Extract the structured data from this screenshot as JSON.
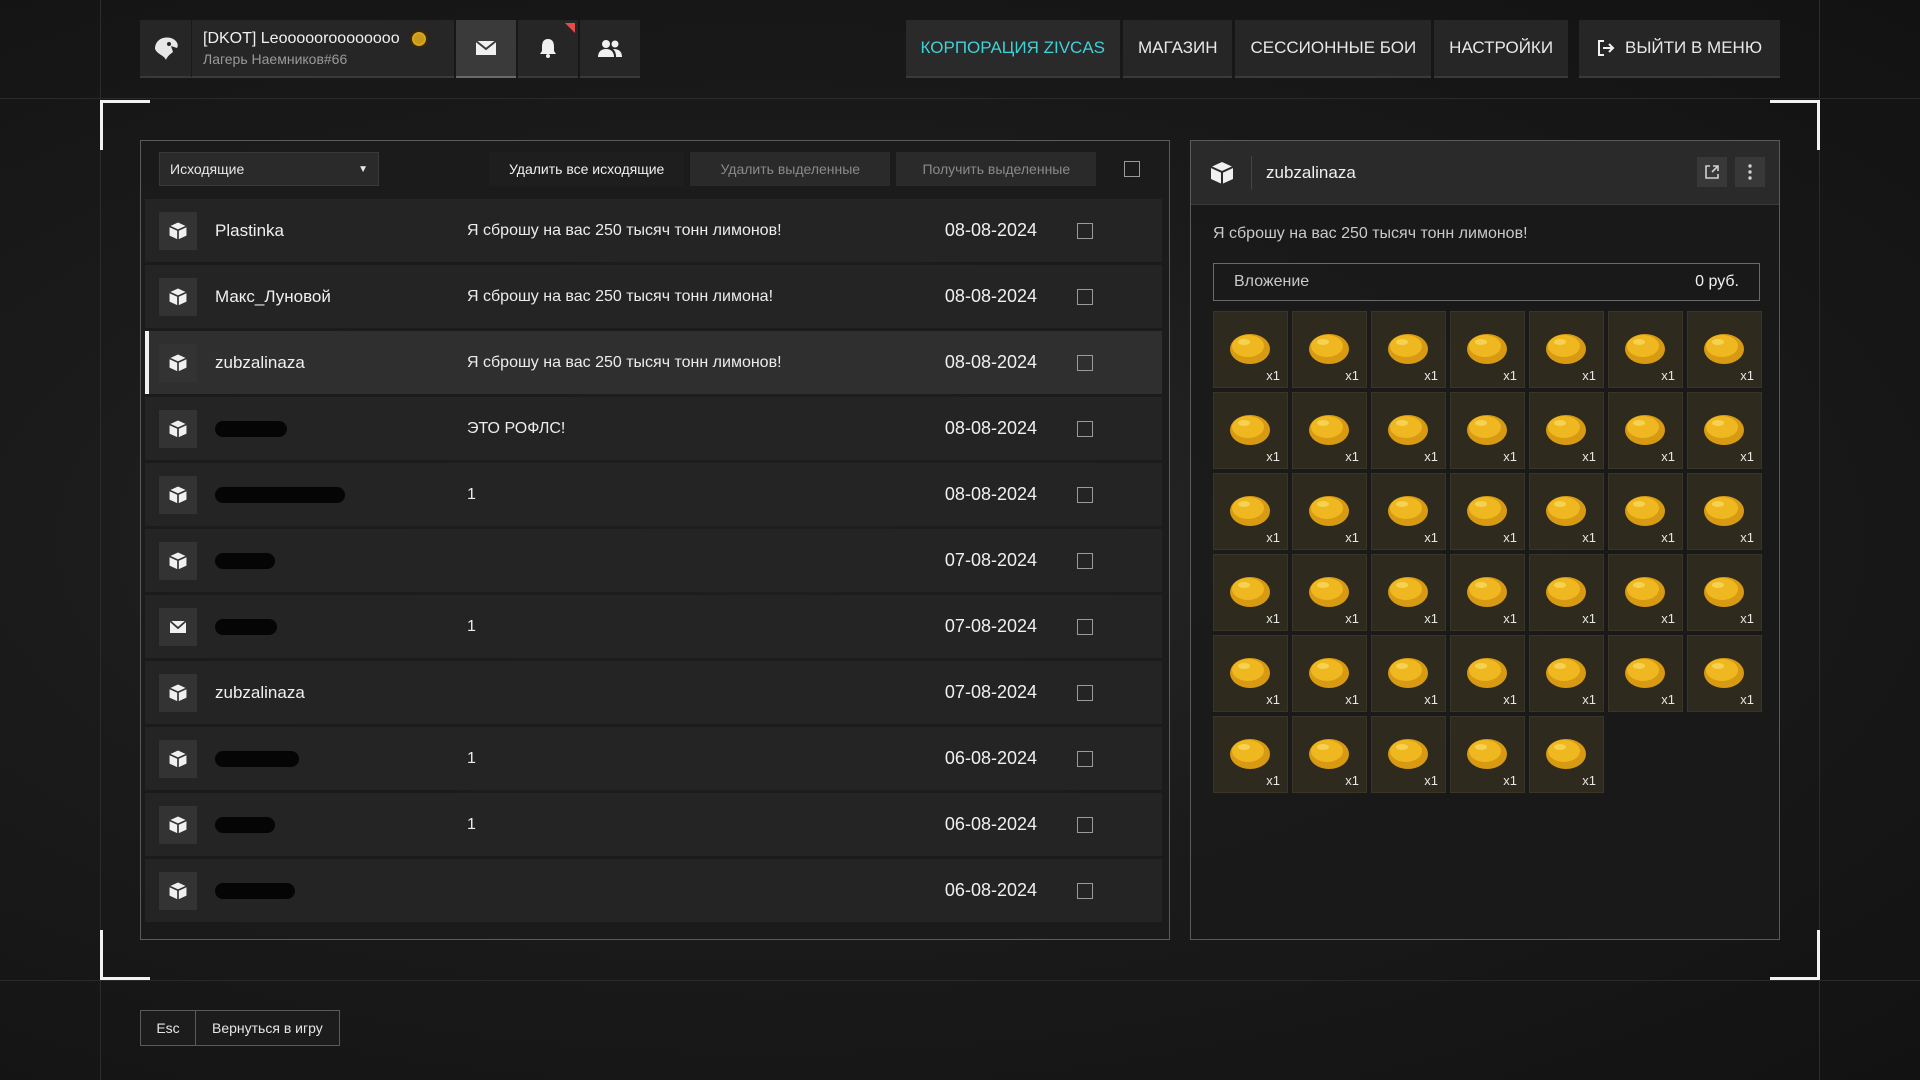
{
  "profile": {
    "name": "[DKOT] Leoooooroooooooo",
    "clan": "Лагерь Наемников#66"
  },
  "top_icons": [
    "mail-icon",
    "bell-icon",
    "friends-icon"
  ],
  "nav": {
    "corp": "КОРПОРАЦИЯ ZIVCAS",
    "shop": "МАГАЗИН",
    "session": "СЕССИОННЫЕ БОИ",
    "settings": "НАСТРОЙКИ",
    "exit": "ВЫЙТИ В МЕНЮ"
  },
  "colors": {
    "accent": "#3fd1d8",
    "notif": "#e84a4a",
    "lemon": "#e0a81a"
  },
  "toolbar": {
    "folder": "Исходящие",
    "delete_all": "Удалить все исходящие",
    "delete_selected": "Удалить выделенные",
    "receive_selected": "Получить выделенные"
  },
  "mails": [
    {
      "icon": "package-icon",
      "sender": "Plastinka",
      "subject": "Я сброшу на вас 250 тысяч тонн лимонов!",
      "date": "08-08-2024"
    },
    {
      "icon": "package-icon",
      "sender": "Макс_Луновой",
      "subject": "Я сброшу на вас 250 тысяч тонн лимона!",
      "date": "08-08-2024"
    },
    {
      "icon": "package-icon",
      "sender": "zubzalinaza",
      "subject": "Я сброшу на вас 250 тысяч тонн лимонов!",
      "date": "08-08-2024"
    },
    {
      "icon": "package-icon",
      "sender": "",
      "subject": "ЭТО РОФЛС!",
      "date": "08-08-2024"
    },
    {
      "icon": "package-icon",
      "sender": "",
      "subject": "1",
      "date": "08-08-2024"
    },
    {
      "icon": "package-icon",
      "sender": "",
      "subject": "",
      "date": "07-08-2024"
    },
    {
      "icon": "mail-icon",
      "sender": "",
      "subject": "1",
      "date": "07-08-2024"
    },
    {
      "icon": "package-icon",
      "sender": "zubzalinaza",
      "subject": "",
      "date": "07-08-2024"
    },
    {
      "icon": "package-icon",
      "sender": "",
      "subject": "1",
      "date": "06-08-2024"
    },
    {
      "icon": "package-icon",
      "sender": "",
      "subject": "1",
      "date": "06-08-2024"
    },
    {
      "icon": "package-icon",
      "sender": "",
      "subject": "",
      "date": "06-08-2024"
    }
  ],
  "detail": {
    "sender": "zubzalinaza",
    "message": "Я сброшу на вас 250 тысяч тонн лимонов!",
    "attachment_label": "Вложение",
    "attachment_value": "0 руб.",
    "item_qty": "x1",
    "item_count": 40,
    "item_icon": "lemon-icon"
  },
  "footer": {
    "esc": "Esc",
    "back": "Вернуться в игру"
  }
}
